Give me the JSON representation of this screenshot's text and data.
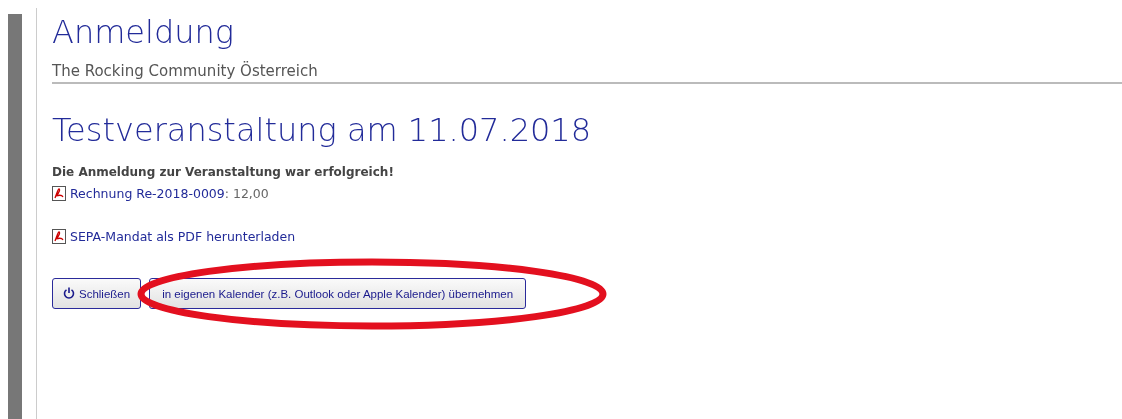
{
  "title": "Anmeldung",
  "subtitle": "The Rocking Community Österreich",
  "event_heading": "Testveranstaltung am 11.07.2018",
  "success_message": "Die Anmeldung zur Veranstaltung war erfolgreich!",
  "invoice": {
    "link": "Rechnung Re-2018-0009",
    "amount": ": 12,00"
  },
  "sepa_link": "SEPA-Mandat als PDF herunterladen",
  "buttons": [
    {
      "kind": "close",
      "label": "Schließen"
    },
    {
      "kind": "calendar",
      "label": "in eigenen Kalender (z.B. Outlook oder Apple Kalender) übernehmen",
      "highlighted": true
    }
  ]
}
